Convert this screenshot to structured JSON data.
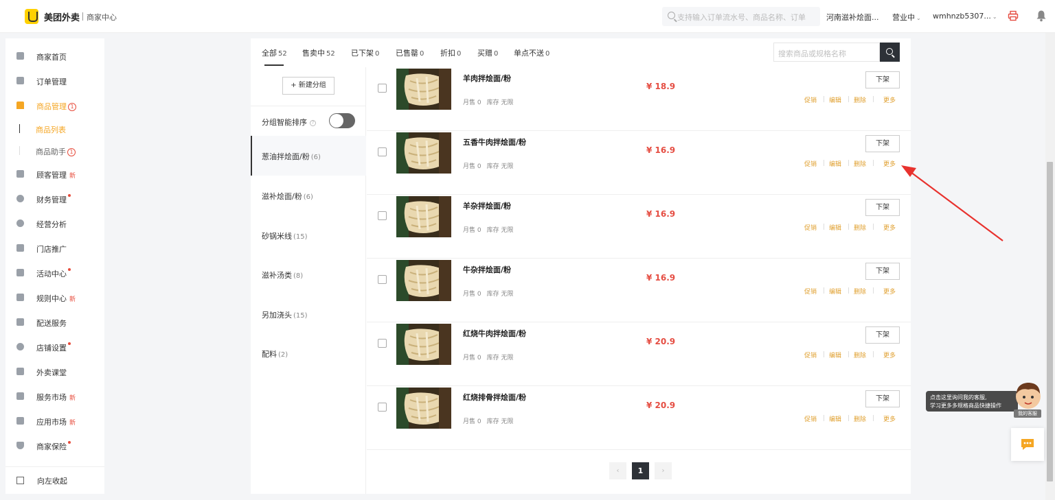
{
  "header": {
    "brand": "美团外卖",
    "sub": "商家中心",
    "search_placeholder": "支持输入订单流水号、商品名称、订单",
    "store_name": "河南滋补烩面...",
    "status": "营业中",
    "account": "wmhnzb5307...",
    "brand_color": "#ffd100"
  },
  "sidebar": {
    "items": [
      {
        "label": "商家首页",
        "icon": "home-grid-icon"
      },
      {
        "label": "订单管理",
        "icon": "order-icon"
      },
      {
        "label": "商品管理",
        "icon": "product-icon",
        "badge": "1"
      },
      {
        "label": "顾客管理",
        "icon": "customer-icon",
        "new": "新"
      },
      {
        "label": "财务管理",
        "icon": "finance-icon"
      },
      {
        "label": "经营分析",
        "icon": "analysis-icon"
      },
      {
        "label": "门店推广",
        "icon": "promo-icon"
      },
      {
        "label": "活动中心",
        "icon": "gift-icon"
      },
      {
        "label": "规则中心",
        "icon": "rules-icon",
        "new": "新"
      },
      {
        "label": "配送服务",
        "icon": "delivery-icon"
      },
      {
        "label": "店铺设置",
        "icon": "settings-icon"
      },
      {
        "label": "外卖课堂",
        "icon": "book-icon"
      },
      {
        "label": "服务市场",
        "icon": "market-icon",
        "new": "新"
      },
      {
        "label": "应用市场",
        "icon": "app-icon",
        "new": "新"
      },
      {
        "label": "商家保险",
        "icon": "shield-icon"
      }
    ],
    "sub_items": [
      {
        "label": "商品列表"
      },
      {
        "label": "商品助手",
        "badge": "1"
      }
    ],
    "collapse": "向左收起",
    "accent": "#f5a623"
  },
  "tabs": [
    {
      "label": "全部",
      "count": "52"
    },
    {
      "label": "售卖中",
      "count": "52"
    },
    {
      "label": "已下架",
      "count": "0"
    },
    {
      "label": "已售罄",
      "count": "0"
    },
    {
      "label": "折扣",
      "count": "0"
    },
    {
      "label": "买赠",
      "count": "0"
    },
    {
      "label": "单点不送",
      "count": "0"
    }
  ],
  "product_search_placeholder": "搜索商品或规格名称",
  "categories": {
    "new_group": "+ 新建分组",
    "smart_sort": "分组智能排序",
    "items": [
      {
        "label": "葱油拌烩面/粉",
        "count": "(6)"
      },
      {
        "label": "滋补烩面/粉",
        "count": "(6)"
      },
      {
        "label": "砂锅米线",
        "count": "(15)"
      },
      {
        "label": "滋补汤类",
        "count": "(8)"
      },
      {
        "label": "另加浇头",
        "count": "(15)"
      },
      {
        "label": "配料",
        "count": "(2)"
      }
    ]
  },
  "products": [
    {
      "name": "羊肉拌烩面/粉",
      "sales": "月售 0",
      "stock": "库存 无限",
      "price": "¥ 18.9"
    },
    {
      "name": "五香牛肉拌烩面/粉",
      "sales": "月售 0",
      "stock": "库存 无限",
      "price": "¥ 16.9"
    },
    {
      "name": "羊杂拌烩面/粉",
      "sales": "月售 0",
      "stock": "库存 无限",
      "price": "¥ 16.9"
    },
    {
      "name": "牛杂拌烩面/粉",
      "sales": "月售 0",
      "stock": "库存 无限",
      "price": "¥ 16.9"
    },
    {
      "name": "红烧牛肉拌烩面/粉",
      "sales": "月售 0",
      "stock": "库存 无限",
      "price": "¥ 20.9"
    },
    {
      "name": "红烧排骨拌烩面/粉",
      "sales": "月售 0",
      "stock": "库存 无限",
      "price": "¥ 20.9"
    }
  ],
  "product_actions": {
    "off": "下架",
    "promo": "促销",
    "edit": "编辑",
    "delete": "删除",
    "more": "更多"
  },
  "pager": {
    "prev": "‹",
    "current": "1",
    "next": "›"
  },
  "customer_service": {
    "line1": "点击这里询问我的客服,",
    "line2": "学习更多多规格商品快捷操作",
    "tag": "我的客服"
  }
}
